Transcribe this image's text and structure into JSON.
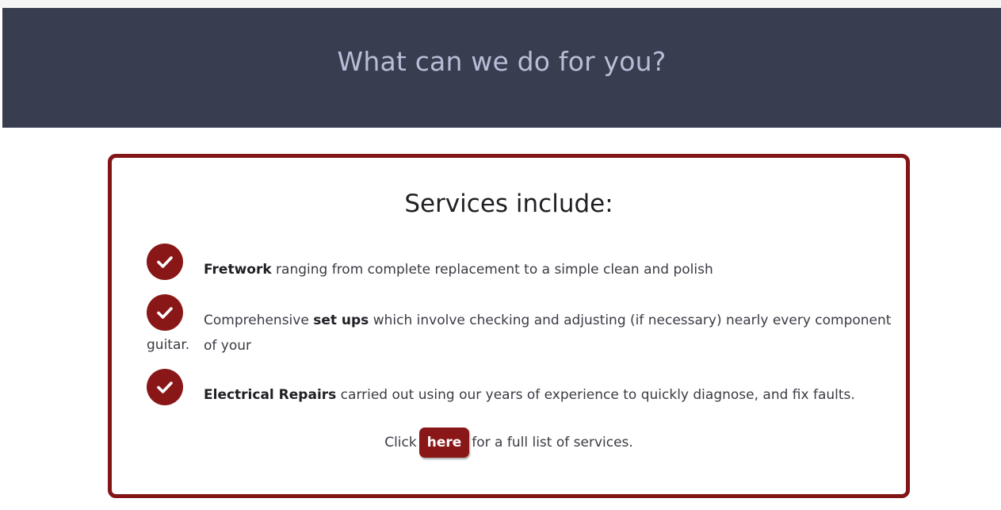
{
  "header": {
    "title": "What can we do for you?"
  },
  "services": {
    "title": "Services include:",
    "items": [
      {
        "icon": "check-circle-icon",
        "bold": "Fretwork",
        "before": "",
        "after": " ranging from complete replacement to a simple clean and polish"
      },
      {
        "icon": "check-circle-icon",
        "before": "Comprehensive ",
        "bold": "set ups",
        "after": " which involve checking and adjusting (if necessary) nearly every component of your",
        "continuation": "guitar."
      },
      {
        "icon": "check-circle-icon",
        "bold": "Electrical Repairs",
        "before": "",
        "after": " carried out using our years of experience to quickly diagnose, and fix faults."
      }
    ],
    "cta": {
      "before": "Click",
      "button_label": "here",
      "after": "for a full list of services."
    }
  },
  "colors": {
    "header_bg": "#393d50",
    "header_text": "#b7bfd8",
    "accent": "#8a1718",
    "card_border": "#831516"
  }
}
